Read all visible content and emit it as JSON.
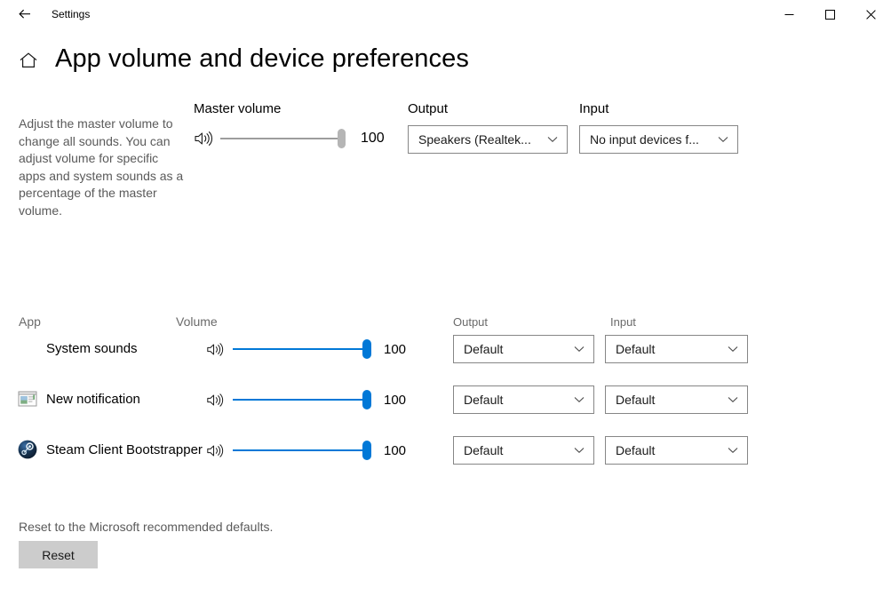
{
  "window": {
    "title": "Settings",
    "back_icon": "back-arrow-icon",
    "minimize_icon": "minimize-icon",
    "maximize_icon": "maximize-icon",
    "close_icon": "close-icon"
  },
  "header": {
    "home_icon": "home-icon",
    "page_title": "App volume and device preferences"
  },
  "description": "Adjust the master volume to change all sounds. You can adjust volume for specific apps and system sounds as a percentage of the master volume.",
  "master": {
    "label": "Master volume",
    "speaker_icon": "speaker-icon",
    "value": "100",
    "percent": 100
  },
  "devices": {
    "output_label": "Output",
    "output_value": "Speakers (Realtek...",
    "input_label": "Input",
    "input_value": "No input devices f...",
    "chevron_icon": "chevron-down-icon"
  },
  "app_list": {
    "header_app": "App",
    "header_volume": "Volume",
    "header_output": "Output",
    "header_input": "Input",
    "rows": [
      {
        "name": "System sounds",
        "icon": "none",
        "speaker_icon": "speaker-icon",
        "volume": "100",
        "percent": 100,
        "output": "Default",
        "input": "Default"
      },
      {
        "name": "New notification",
        "icon": "notification-window-icon",
        "speaker_icon": "speaker-icon",
        "volume": "100",
        "percent": 100,
        "output": "Default",
        "input": "Default"
      },
      {
        "name": "Steam Client Bootstrapper",
        "icon": "steam-icon",
        "speaker_icon": "speaker-icon",
        "volume": "100",
        "percent": 100,
        "output": "Default",
        "input": "Default"
      }
    ]
  },
  "reset": {
    "text": "Reset to the Microsoft recommended defaults.",
    "button_label": "Reset"
  },
  "colors": {
    "accent_blue": "#0078d7",
    "master_slider_gray": "#b5b5b5",
    "border_gray": "#868686",
    "muted_text": "#5a5a5a",
    "button_gray": "#cccccc"
  }
}
